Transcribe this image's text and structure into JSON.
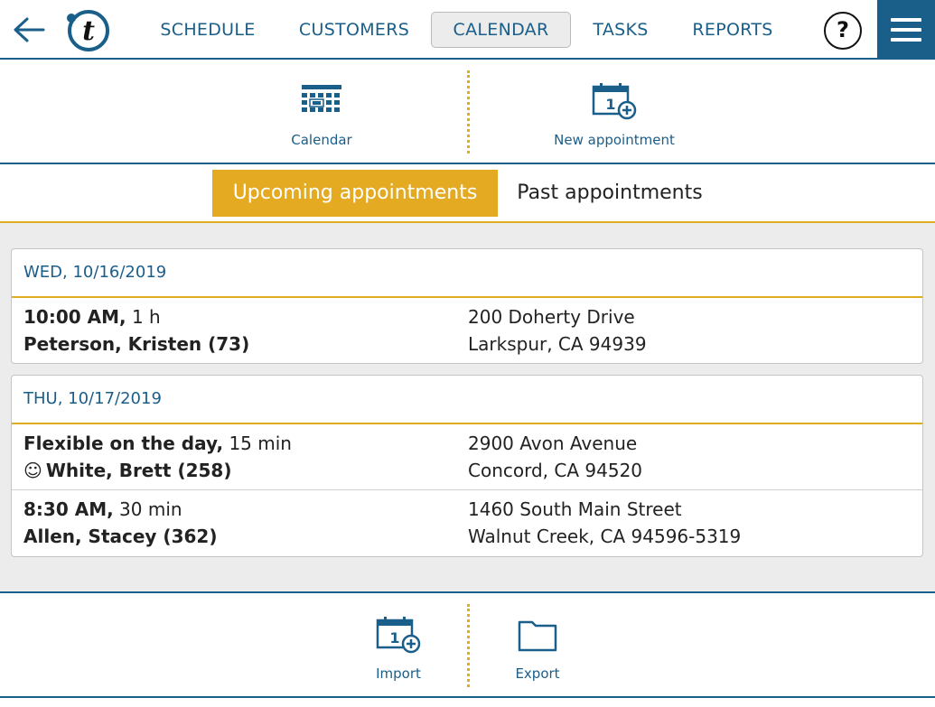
{
  "nav": {
    "back_icon": "arrow-left-icon",
    "logo_letter": "t",
    "items": [
      {
        "label": "SCHEDULE"
      },
      {
        "label": "CUSTOMERS"
      },
      {
        "label": "CALENDAR"
      },
      {
        "label": "TASKS"
      },
      {
        "label": "REPORTS"
      }
    ],
    "active": "CALENDAR",
    "help_label": "?",
    "menu_icon": "hamburger-icon"
  },
  "actions": [
    {
      "label": "Calendar",
      "icon": "calendar-grid-icon"
    },
    {
      "label": "New appointment",
      "icon": "calendar-add-icon"
    }
  ],
  "tabs": [
    {
      "label": "Upcoming appointments",
      "active": true
    },
    {
      "label": "Past appointments",
      "active": false
    }
  ],
  "days": [
    {
      "date": "WED, 10/16/2019",
      "appointments": [
        {
          "time": "10:00 AM,",
          "duration": "1 h",
          "customer": "Peterson, Kristen (73)",
          "address1": "200 Doherty Drive",
          "address2": "Larkspur, CA 94939"
        }
      ]
    },
    {
      "date": "THU, 10/17/2019",
      "appointments": [
        {
          "time": "Flexible on the day,",
          "duration": "15 min",
          "customer_prefix": "☺",
          "customer": "White, Brett (258)",
          "address1": "2900 Avon Avenue",
          "address2": "Concord, CA 94520"
        },
        {
          "time": "8:30 AM,",
          "duration": "30 min",
          "customer": "Allen, Stacey (362)",
          "address1": "1460 South Main Street",
          "address2": "Walnut Creek, CA 94596-5319"
        }
      ]
    }
  ],
  "bottom_actions": [
    {
      "label": "Import",
      "icon": "calendar-add-icon"
    },
    {
      "label": "Export",
      "icon": "folder-icon"
    }
  ],
  "colors": {
    "primary": "#1a5e8a",
    "accent": "#e3aa22",
    "background": "#ececec"
  }
}
